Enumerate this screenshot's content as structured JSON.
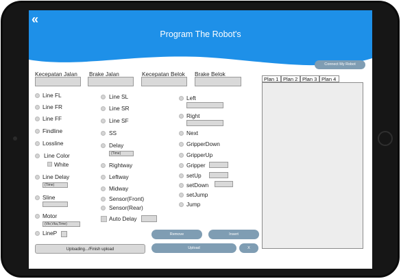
{
  "header": {
    "title": "Program The Robot's"
  },
  "connect_button": "Connect My Robot",
  "speeds": [
    {
      "label": "Kecepatan Jalan",
      "value": ""
    },
    {
      "label": "Brake Jalan",
      "value": ""
    },
    {
      "label": "Kecepatan Belok",
      "value": ""
    },
    {
      "label": "Brake Belok",
      "value": ""
    }
  ],
  "col1": [
    "Line FL",
    "Line FR",
    "Line FF",
    "Findline",
    "Lossline",
    "Line Color",
    "White",
    "Line Delay",
    "Sline",
    "Motor",
    "LineP"
  ],
  "col1_hints": {
    "line_delay": "(Time)",
    "motor": "(Vkr,Vka,Time)"
  },
  "col2": [
    "Line SL",
    "Line SR",
    "Line SF",
    "SS",
    "Delay",
    "Rightway",
    "Leftway",
    "Midway",
    "Sensor(Front)",
    "Sensor(Rear)",
    "Auto Delay"
  ],
  "col2_hints": {
    "delay": "(Time)"
  },
  "col3": [
    "Left",
    "Right",
    "Next",
    "GripperDown",
    "GripperUp",
    "Gripper",
    "setUp",
    "setDown",
    "setJump",
    "Jump"
  ],
  "plans": [
    "Plan 1",
    "Plan 2",
    "Plan 3",
    "Plan 4"
  ],
  "buttons": {
    "remove": "Remove",
    "insert": "Insert",
    "upload": "Upload",
    "close": "X",
    "upload_status": "Uploading.../Finish upload"
  }
}
